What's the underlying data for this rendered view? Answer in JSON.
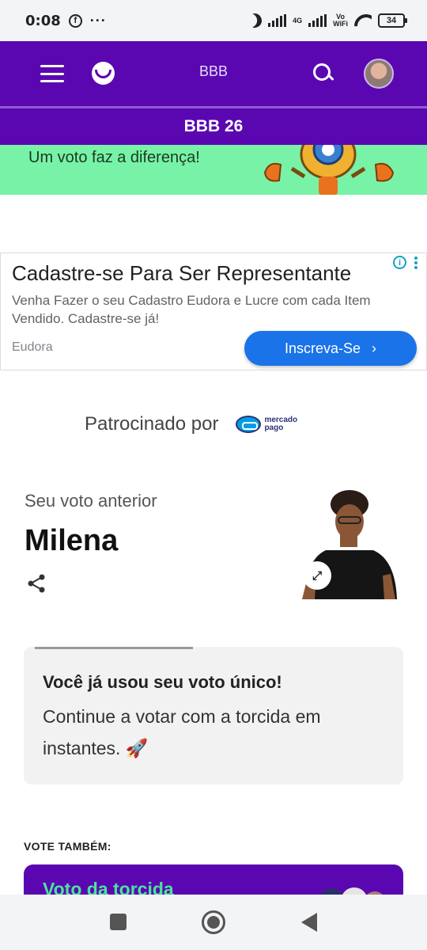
{
  "status_bar": {
    "time": "0:08",
    "dots": "···",
    "network": "4G",
    "vowifi_top": "Vo",
    "vowifi_bottom": "WiFi",
    "battery": "34"
  },
  "header": {
    "title": "BBB",
    "subtitle": "BBB 26"
  },
  "banner": {
    "slogan": "Um voto faz a diferença!",
    "background": "#78f2a6"
  },
  "ad": {
    "title": "Cadastre-se Para Ser Representante",
    "description": "Venha Fazer o seu Cadastro Eudora e Lucre com cada Item Vendido. Cadastre-se já!",
    "brand": "Eudora",
    "cta": "Inscreva-Se",
    "info_icon": "i"
  },
  "sponsor": {
    "label": "Patrocinado por",
    "logo_line1": "mercado",
    "logo_line2": "pago"
  },
  "previous_vote": {
    "label": "Seu voto anterior",
    "name": "Milena"
  },
  "notice": {
    "title": "Você já usou seu voto único!",
    "body": "Continue a votar com a torcida em instantes. 🚀"
  },
  "vote_also": {
    "label": "VOTE TAMBÉM:",
    "card_title": "Voto da torcida"
  },
  "colors": {
    "brand_purple": "#5b07b1",
    "accent_green": "#48e59b",
    "ad_blue": "#1a73e8"
  }
}
